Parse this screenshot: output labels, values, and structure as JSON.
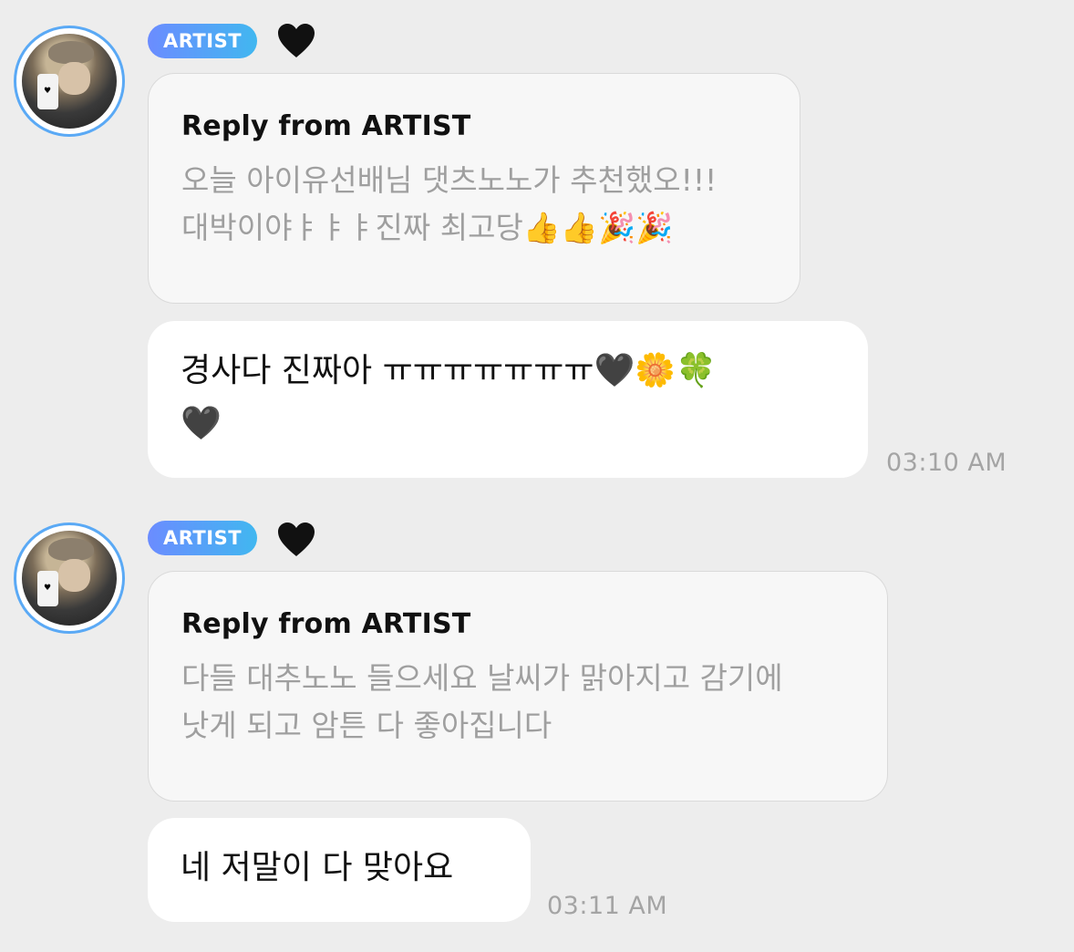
{
  "messages": [
    {
      "badge": "ARTIST",
      "heart": "🖤",
      "reply_title": "Reply from ARTIST",
      "reply_text": "오늘 아이유선배님 댓츠노노가 추천했오!!!\n대박이야ㅑㅑㅑ진짜 최고당👍👍🎉🎉",
      "message": "경사다 진짜아 ㅠㅠㅠㅠㅠㅠㅠ🖤🌼🍀\n🖤",
      "time": "03:10 AM"
    },
    {
      "badge": "ARTIST",
      "heart": "🖤",
      "reply_title": "Reply from ARTIST",
      "reply_text": "다들 대추노노 들으세요 날씨가 맑아지고 감기에\n낫게 되고 암튼 다 좋아집니다",
      "message": "네 저말이 다 맞아요",
      "time": "03:11 AM"
    }
  ],
  "icons": {
    "avatar": "avatar-icon",
    "heart": "black-heart-icon"
  },
  "colors": {
    "background": "#ededed",
    "badge_start": "#6b8cff",
    "badge_end": "#41b7f0",
    "avatar_ring": "#5aa9f5",
    "reply_text": "#9f9f9f",
    "time_text": "#a4a4a4"
  }
}
